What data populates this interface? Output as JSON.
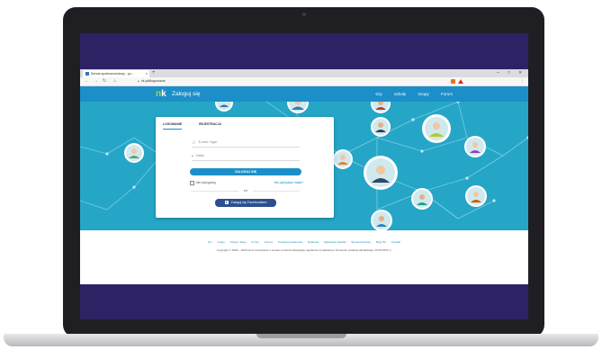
{
  "browser": {
    "tab_title": "Serwis społecznościowy - po...",
    "new_tab": "+",
    "window_controls": "─ □ ✕",
    "url": "nk.pl/#logowanie",
    "ext_colors": [
      "#e8711c",
      "#d93025"
    ]
  },
  "site": {
    "logo_n": "n",
    "logo_k": "k",
    "header_title": "Zaloguj się",
    "nav": [
      "Gry",
      "Szkoły",
      "Grupy",
      "Forum"
    ]
  },
  "login": {
    "tab_login": "LOGOWANIE",
    "tab_register": "REJESTRACJA",
    "email_placeholder": "E-mail / login",
    "password_placeholder": "Hasło",
    "login_button": "ZALOGUJ SIĘ",
    "remember_label": "Nie wylogowuj",
    "forgot_link": "Nie pamiętasz hasła?",
    "or_label": "lub",
    "facebook_button": "Zaloguj się Facebookiem"
  },
  "footer": {
    "links": [
      "Gry",
      "Grupy",
      "Szkoły i klasy",
      "Forum",
      "Pomoc",
      "Polityka prywatności",
      "Reklama",
      "Zgłaszanie błędów",
      "Bezpieczeństwo",
      "Blog NK",
      "Kontakt"
    ],
    "copyright": "Copyright © 2006 – 2020 nk.pl, korzystanie z serwisu oznacza akceptację regulaminu w aktualnym brzmieniu (ostatnia aktualizacja: 15.05.2019 r.)"
  },
  "colors": {
    "brand_blue": "#1c8fc9",
    "hero_bg": "#26a6c7",
    "screen_frame": "#2d2364",
    "facebook": "#2c4f8f",
    "logo_accent": "#9fdc3a"
  }
}
